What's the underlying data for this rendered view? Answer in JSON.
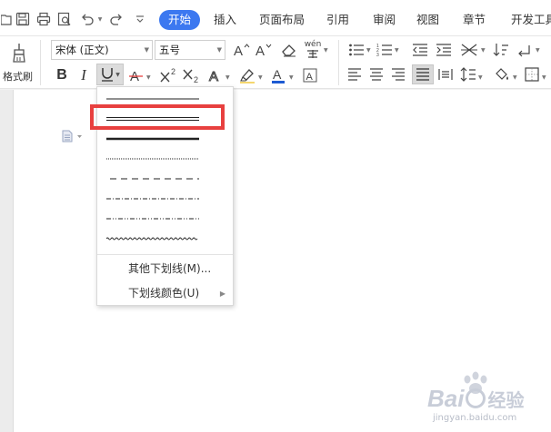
{
  "menu_tabs": [
    "开始",
    "插入",
    "页面布局",
    "引用",
    "审阅",
    "视图",
    "章节",
    "开发工具"
  ],
  "format_painter_label": "格式刷",
  "font": {
    "name": "宋体 (正文)",
    "size": "五号"
  },
  "pinyin_label": "wén",
  "underline_menu": {
    "styles": [
      "single",
      "double",
      "thick",
      "dotted",
      "dashed",
      "dash-dot",
      "dash-dot-dot",
      "wave"
    ],
    "more_label": "其他下划线(M)...",
    "color_label": "下划线颜色(U)"
  },
  "colors": {
    "accent": "#3c78f0",
    "highlight": "#e8403f",
    "font_color": "#1e5bd2",
    "highlighter": "#f5d76e"
  },
  "watermark": {
    "brand": "Bai",
    "cn": "经验",
    "url": "jingyan.baidu.com"
  }
}
